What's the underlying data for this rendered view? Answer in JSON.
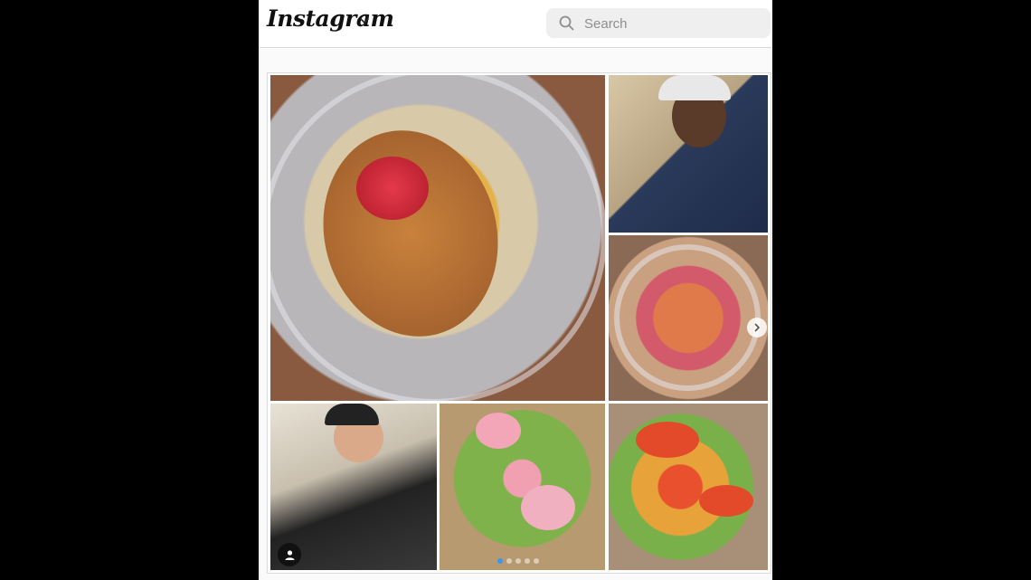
{
  "header": {
    "logo_text": "Instagram",
    "logo_icon": "instagram-wordmark",
    "account_menu_icon": "chevron-down-icon"
  },
  "search": {
    "placeholder": "Search",
    "value": "",
    "icon": "search-icon"
  },
  "post": {
    "carousel": {
      "total_slides": 5,
      "active_index": 0
    },
    "tag_icon": "user-tag-icon",
    "next_icon": "chevron-right-icon"
  },
  "colors": {
    "page_bg": "#fafafa",
    "header_bg": "#ffffff",
    "border": "#dbdbdb",
    "search_bg": "#efefef",
    "active_dot": "#3897f0"
  }
}
